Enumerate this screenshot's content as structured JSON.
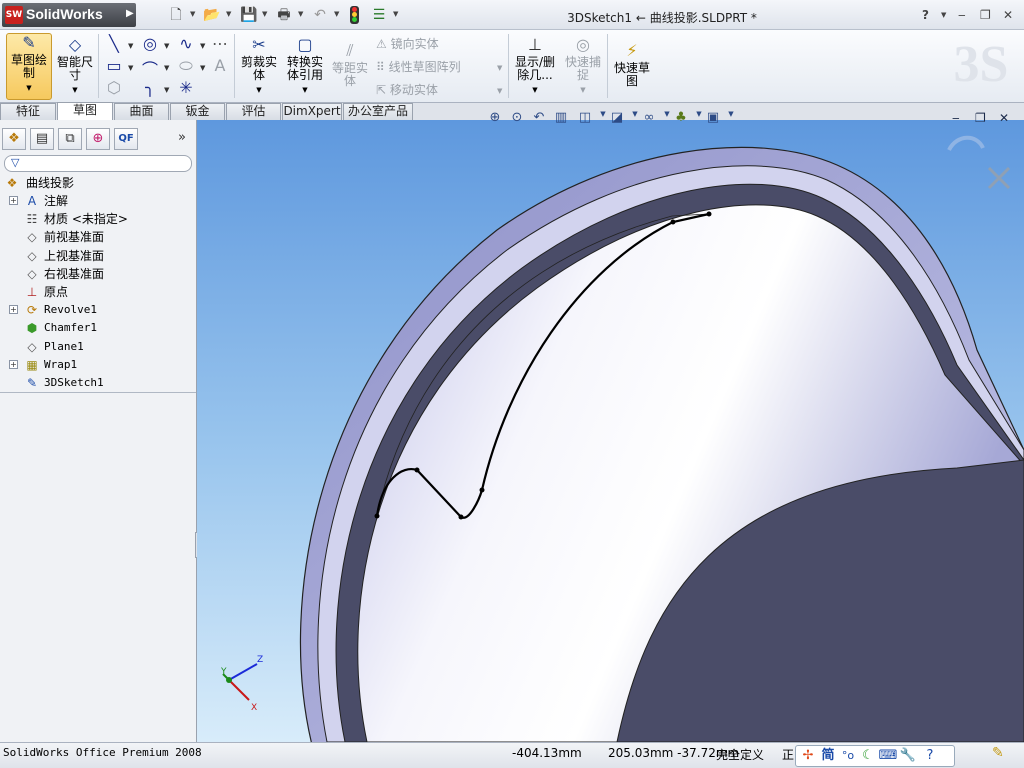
{
  "app": {
    "brand": "SolidWorks",
    "logo_mark": "SW",
    "doc_title": "3DSketch1 ← 曲线投影.SLDPRT *",
    "help": "?"
  },
  "ribbon": {
    "sketch": "草图绘制",
    "smart_dim": "智能尺寸",
    "trim": "剪裁实体",
    "convert": "转换实体引用",
    "offset": "等距实体",
    "mirror": "镜向实体",
    "linear_pattern": "线性草图阵列",
    "move": "移动实体",
    "show_delete": "显示/删除几...",
    "quick_snap": "快速捕捉",
    "rapid_sketch": "快速草图"
  },
  "tabs": [
    "特征",
    "草图",
    "曲面",
    "钣金",
    "评估",
    "DimXpert",
    "办公室产品"
  ],
  "active_tab": 1,
  "tree": {
    "root": "曲线投影",
    "items": [
      {
        "label": "注解",
        "icon": "annotation-icon",
        "expand": true
      },
      {
        "label": "材质 <未指定>",
        "icon": "material-icon",
        "expand": false
      },
      {
        "label": "前视基准面",
        "icon": "plane-icon",
        "expand": false
      },
      {
        "label": "上视基准面",
        "icon": "plane-icon",
        "expand": false
      },
      {
        "label": "右视基准面",
        "icon": "plane-icon",
        "expand": false
      },
      {
        "label": "原点",
        "icon": "origin-icon",
        "expand": false
      },
      {
        "label": "Revolve1",
        "icon": "revolve-icon",
        "expand": true
      },
      {
        "label": "Chamfer1",
        "icon": "chamfer-icon",
        "expand": false
      },
      {
        "label": "Plane1",
        "icon": "plane-icon",
        "expand": false
      },
      {
        "label": "Wrap1",
        "icon": "wrap-icon",
        "expand": true
      },
      {
        "label": "3DSketch1",
        "icon": "3dsketch-icon",
        "expand": false
      }
    ]
  },
  "triad": {
    "x": "X",
    "y": "Y",
    "z": "Z"
  },
  "status": {
    "product": "SolidWorks Office Premium 2008",
    "coord_x": "-404.13mm",
    "coord_yz": "205.03mm  -37.72mm",
    "state": "完全定义",
    "extra": "正"
  },
  "ime": {
    "mode": "简",
    "punct": "°o"
  },
  "colors": {
    "accent": "#f6c95e",
    "sky_top": "#5e98de",
    "part": "#e6e6f4"
  }
}
